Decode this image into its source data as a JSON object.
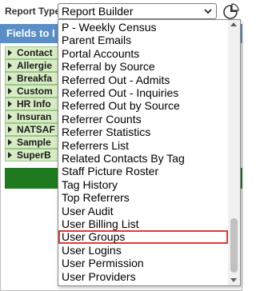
{
  "toolbar": {
    "report_type_label": "Report Type:",
    "selected_report": "Report Builder",
    "chevron_icon": "chevron-down-icon",
    "chart_icon": "pie-chart-icon"
  },
  "fields_panel": {
    "header": "Fields to I",
    "categories": [
      {
        "label": "Contact"
      },
      {
        "label": "Allergie"
      },
      {
        "label": "Breakfa"
      },
      {
        "label": "Custom"
      },
      {
        "label": "HR Info"
      },
      {
        "label": "Insuran"
      },
      {
        "label": "NATSAF"
      },
      {
        "label": "Sample"
      },
      {
        "label": "SuperB"
      }
    ]
  },
  "dropdown": {
    "options": [
      {
        "label": "P - Weekly Census"
      },
      {
        "label": "Parent Emails"
      },
      {
        "label": "Portal Accounts"
      },
      {
        "label": "Referral by Source"
      },
      {
        "label": "Referred Out - Admits"
      },
      {
        "label": "Referred Out - Inquiries"
      },
      {
        "label": "Referred Out by Source"
      },
      {
        "label": "Referrer Counts"
      },
      {
        "label": "Referrer Statistics"
      },
      {
        "label": "Referrers List"
      },
      {
        "label": "Related Contacts By Tag"
      },
      {
        "label": "Staff Picture Roster"
      },
      {
        "label": "Tag History"
      },
      {
        "label": "Top Referrers"
      },
      {
        "label": "User Audit"
      },
      {
        "label": "User Billing List"
      },
      {
        "label": "User Groups",
        "highlighted": true
      },
      {
        "label": "User Logins"
      },
      {
        "label": "User Permission"
      },
      {
        "label": "User Providers"
      }
    ]
  },
  "colors": {
    "header_blue": "#5b8ec6",
    "category_green": "#d7ecc4",
    "bar_green": "#1f7a1f",
    "highlight_red": "#e03a3a"
  }
}
